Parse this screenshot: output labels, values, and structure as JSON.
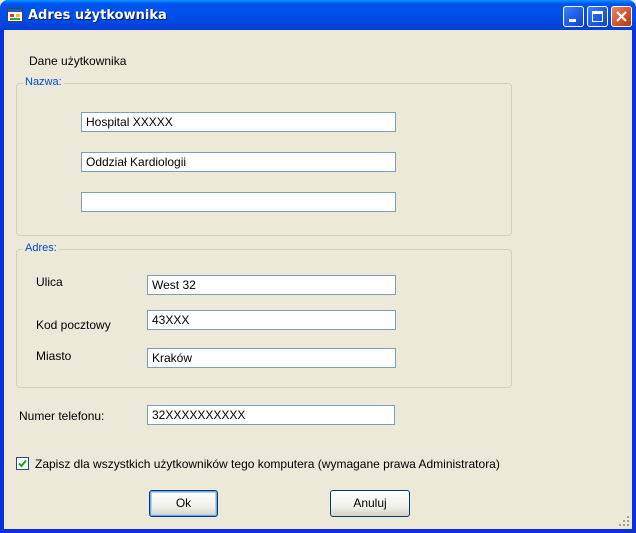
{
  "window": {
    "title": "Adres użytkownika"
  },
  "header": {
    "label": "Dane użytkownika"
  },
  "nazwa_group": {
    "title": "Nazwa:",
    "line1": "Hospital XXXXX",
    "line2": "Oddział Kardiologii",
    "line3": ""
  },
  "adres_group": {
    "title": "Adres:",
    "ulica_label": "Ulica",
    "ulica_value": "West 32",
    "kod_label": "Kod pocztowy",
    "kod_value": "43XXX",
    "miasto_label": "Miasto",
    "miasto_value": "Kraków"
  },
  "phone": {
    "label": "Numer telefonu:",
    "value": "32XXXXXXXXXX"
  },
  "checkbox": {
    "label": "Zapisz dla wszystkich użytkowników tego komputera (wymagane prawa Administratora)",
    "checked": true
  },
  "buttons": {
    "ok": "Ok",
    "cancel": "Anuluj"
  },
  "colors": {
    "title_bar": "#0054e3",
    "group_title": "#0046d5",
    "background": "#ece9d8"
  }
}
